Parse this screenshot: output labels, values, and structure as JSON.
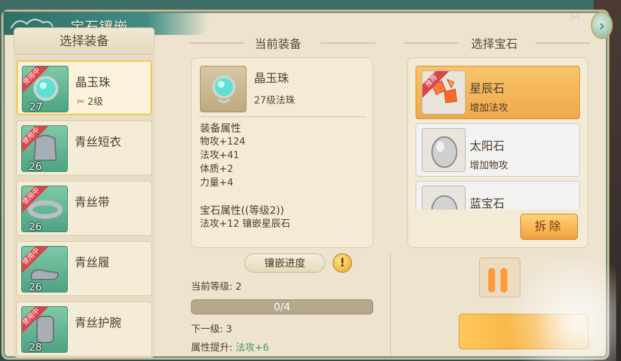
{
  "window": {
    "title": "宝石镶嵌",
    "corner_tag": "34"
  },
  "left": {
    "header": "选择装备",
    "items": [
      {
        "name": "晶玉珠",
        "level": "27",
        "sub": "2级",
        "badge": "使用中",
        "selected": true,
        "icon": "jade-orb-icon"
      },
      {
        "name": "青丝短衣",
        "level": "26",
        "sub": "",
        "badge": "使用中",
        "selected": false,
        "icon": "armor-icon"
      },
      {
        "name": "青丝带",
        "level": "26",
        "sub": "",
        "badge": "使用中",
        "selected": false,
        "icon": "belt-icon"
      },
      {
        "name": "青丝履",
        "level": "26",
        "sub": "",
        "badge": "使用中",
        "selected": false,
        "icon": "boots-icon"
      },
      {
        "name": "青丝护腕",
        "level": "28",
        "sub": "",
        "badge": "使用中",
        "selected": false,
        "icon": "bracer-icon"
      }
    ]
  },
  "current": {
    "header": "当前装备",
    "name": "晶玉珠",
    "type": "27级法珠",
    "equip_attr_title": "装备属性",
    "equip_attrs": [
      "物攻+124",
      "法攻+41",
      "体质+2",
      "力量+4"
    ],
    "gem_attr_title": "宝石属性((等级2))",
    "gem_attr": "法攻+12 镶嵌星辰石"
  },
  "progress": {
    "tab_label": "镶嵌进度",
    "warn": "!",
    "current_level_label": "当前等级: 2",
    "bar_text": "0/4",
    "fill_fraction": 0,
    "next_level_label": "下一级: 3",
    "attr_up_label": "属性提升: ",
    "attr_up_value": "法攻+6"
  },
  "gems": {
    "header": "选择宝石",
    "items": [
      {
        "name": "星辰石",
        "desc": "增加法攻",
        "badge": "推荐",
        "selected": true,
        "icon": "star-stone-icon"
      },
      {
        "name": "太阳石",
        "desc": "增加物攻",
        "badge": "",
        "selected": false,
        "icon": "sun-stone-icon"
      },
      {
        "name": "蓝宝石",
        "desc": "",
        "badge": "",
        "selected": false,
        "icon": "sapphire-icon"
      }
    ],
    "remove_label": "拆除"
  },
  "colors": {
    "accent": "#f5c542",
    "selected_gem": "#f0a94a",
    "green_text": "#3a9a5a"
  }
}
